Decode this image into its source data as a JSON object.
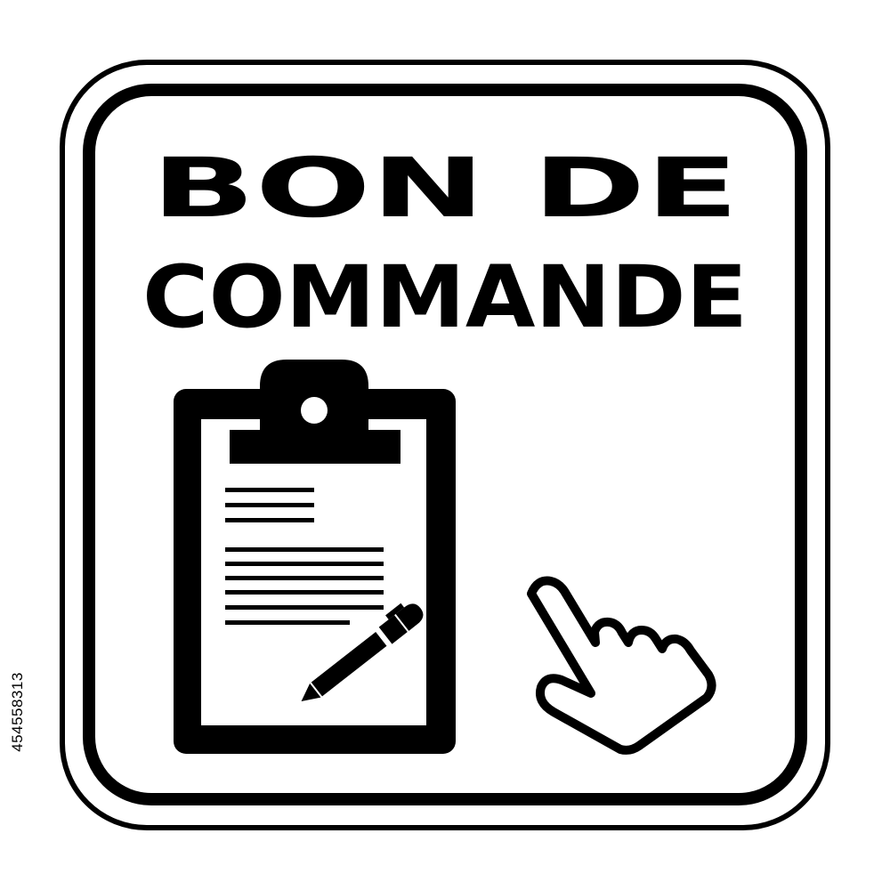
{
  "sign": {
    "title_line1": "BON DE",
    "title_line2": "COMMANDE",
    "icons": {
      "clipboard": "clipboard-icon",
      "pen": "pen-icon",
      "pointer": "pointing-hand-icon"
    },
    "colors": {
      "ink": "#000000",
      "background": "#ffffff"
    }
  },
  "stock_id": "454558313"
}
